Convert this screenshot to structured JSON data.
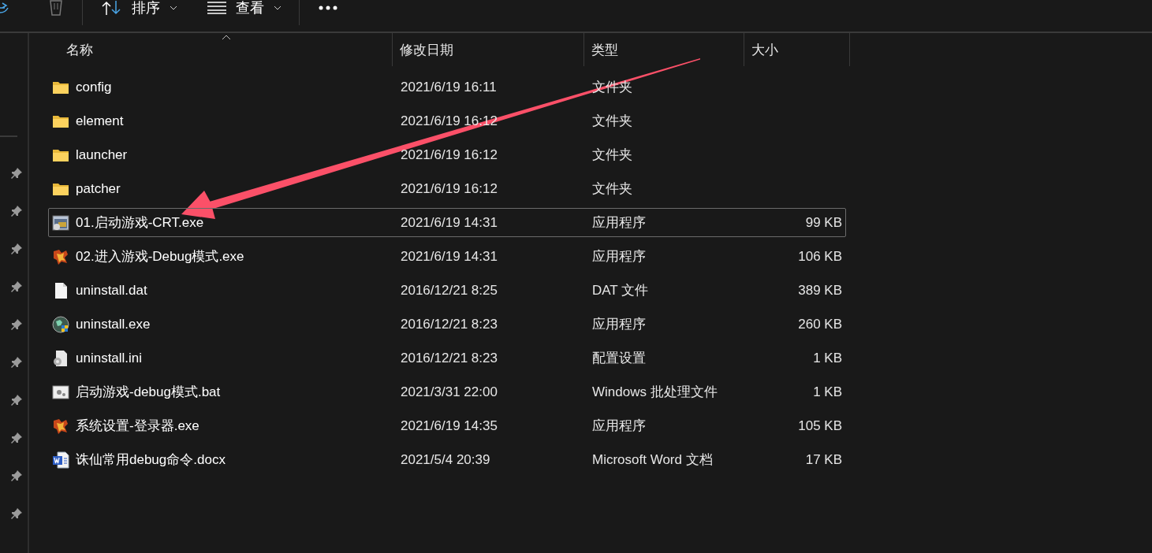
{
  "toolbar": {
    "sort": {
      "label": "排序"
    },
    "view": {
      "label": "查看"
    }
  },
  "nav_pane": {
    "pins": [
      {
        "pinned": true
      },
      {
        "pinned": true
      },
      {
        "pinned": true
      },
      {
        "pinned": true
      },
      {
        "pinned": true
      },
      {
        "pinned": true
      },
      {
        "pinned": true
      },
      {
        "pinned": true
      },
      {
        "pinned": true
      },
      {
        "pinned": true
      }
    ]
  },
  "columns": [
    {
      "label": "名称",
      "sorted": true
    },
    {
      "label": "修改日期",
      "sorted": false
    },
    {
      "label": "类型",
      "sorted": false
    },
    {
      "label": "大小",
      "sorted": false
    }
  ],
  "rows": [
    {
      "name": "config",
      "date": "2021/6/19 16:11",
      "type": "文件夹",
      "kind": "folder",
      "selected": false
    },
    {
      "name": "element",
      "date": "2021/6/19 16:12",
      "type": "文件夹",
      "kind": "folder",
      "selected": false
    },
    {
      "name": "launcher",
      "date": "2021/6/19 16:12",
      "type": "文件夹",
      "kind": "folder",
      "selected": false
    },
    {
      "name": "patcher",
      "date": "2021/6/19 16:12",
      "type": "文件夹",
      "kind": "folder",
      "selected": false
    },
    {
      "name": "01.启动游戏-CRT.exe",
      "date": "2021/6/19 14:31",
      "type": "应用程序",
      "size": "99 KB",
      "kind": "app",
      "selected": true
    },
    {
      "name": "02.进入游戏-Debug模式.exe",
      "date": "2021/6/19 14:31",
      "type": "应用程序",
      "size": "106 KB",
      "kind": "game",
      "selected": false
    },
    {
      "name": "uninstall.dat",
      "date": "2016/12/21 8:25",
      "type": "DAT 文件",
      "size": "389 KB",
      "kind": "file",
      "selected": false
    },
    {
      "name": "uninstall.exe",
      "date": "2016/12/21 8:23",
      "type": "应用程序",
      "size": "260 KB",
      "kind": "globe",
      "selected": false
    },
    {
      "name": "uninstall.ini",
      "date": "2016/12/21 8:23",
      "type": "配置设置",
      "size": "1 KB",
      "kind": "settings",
      "selected": false
    },
    {
      "name": "启动游戏-debug模式.bat",
      "date": "2021/3/31 22:00",
      "type": "Windows 批处理文件",
      "size": "1 KB",
      "kind": "batch",
      "selected": false
    },
    {
      "name": "系统设置-登录器.exe",
      "date": "2021/6/19 14:35",
      "type": "应用程序",
      "size": "105 KB",
      "kind": "game",
      "selected": false
    },
    {
      "name": "诛仙常用debug命令.docx",
      "date": "2021/5/4 20:39",
      "type": "Microsoft Word 文档",
      "size": "17 KB",
      "kind": "word",
      "selected": false
    }
  ]
}
